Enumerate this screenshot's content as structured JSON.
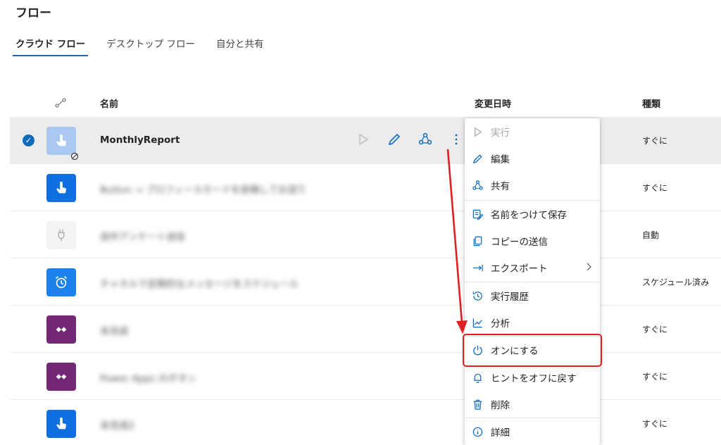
{
  "header": {
    "title": "フロー"
  },
  "tabs": [
    {
      "label": "クラウド フロー",
      "active": true
    },
    {
      "label": "デスクトップ フロー",
      "active": false
    },
    {
      "label": "自分と共有",
      "active": false
    }
  ],
  "table": {
    "columns": {
      "name": "名前",
      "modified": "変更日時",
      "type": "種類"
    },
    "rows": [
      {
        "name": "MonthlyReport",
        "type": "すぐに",
        "icon": "touch-icon",
        "icon_color": "#a9c9f2",
        "selected": true,
        "disabled": true
      },
      {
        "name": "Button → プロフィールカードを投稿してお送り",
        "type": "すぐに",
        "icon": "touch-icon",
        "icon_color": "#0f6fe0"
      },
      {
        "name": "自作アンケート送信",
        "type": "自動",
        "icon": "plug-icon",
        "icon_color": "#f4f4f4"
      },
      {
        "name": "チャネルで定期的なメッセージをスケジュール",
        "type": "スケジュール済み",
        "icon": "alarm-icon",
        "icon_color": "#1a82ea"
      },
      {
        "name": "未完成",
        "type": "すぐに",
        "icon": "power-apps-icon",
        "icon_color": "#742774"
      },
      {
        "name": "Power Apps のボタン",
        "type": "すぐに",
        "icon": "power-apps-icon",
        "icon_color": "#742774"
      },
      {
        "name": "未完成2",
        "type": "すぐに",
        "icon": "touch-icon",
        "icon_color": "#0f6fe0"
      }
    ]
  },
  "context_menu": {
    "items": [
      {
        "label": "実行",
        "icon": "play-icon",
        "disabled": true
      },
      {
        "label": "編集",
        "icon": "pencil-icon"
      },
      {
        "label": "共有",
        "icon": "share-icon"
      },
      {
        "label": "名前をつけて保存",
        "icon": "save-as-icon"
      },
      {
        "label": "コピーの送信",
        "icon": "copy-icon"
      },
      {
        "label": "エクスポート",
        "icon": "export-icon",
        "submenu": true
      },
      {
        "label": "実行履歴",
        "icon": "history-icon"
      },
      {
        "label": "分析",
        "icon": "analytics-icon"
      },
      {
        "label": "オンにする",
        "icon": "power-icon",
        "highlighted": true
      },
      {
        "label": "ヒントをオフに戻す",
        "icon": "bell-icon"
      },
      {
        "label": "削除",
        "icon": "trash-icon"
      },
      {
        "label": "詳細",
        "icon": "info-icon"
      }
    ]
  },
  "colors": {
    "accent": "#0f6cbd",
    "highlight": "#e02020",
    "selected_row": "#ececec"
  }
}
